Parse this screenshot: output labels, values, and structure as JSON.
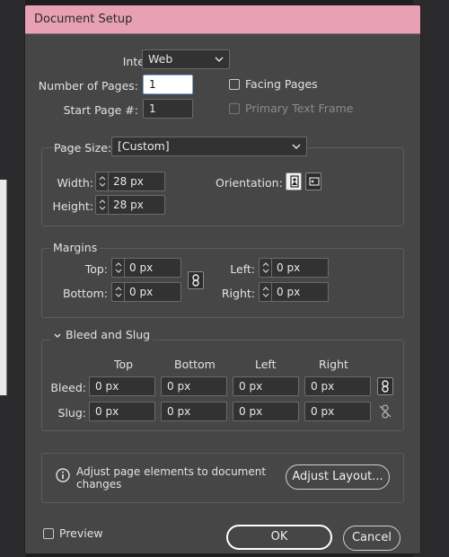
{
  "window": {
    "title": "Document Setup"
  },
  "general": {
    "intent_label": "Intent:",
    "intent_value": "Web",
    "num_pages_label": "Number of Pages:",
    "num_pages_value": "1",
    "start_page_label": "Start Page #:",
    "start_page_value": "1",
    "facing_pages_label": "Facing Pages",
    "facing_pages_checked": false,
    "primary_text_frame_label": "Primary Text Frame",
    "primary_text_frame_checked": false
  },
  "page_size": {
    "label": "Page Size:",
    "value": "[Custom]",
    "width_label": "Width:",
    "width_value": "28 px",
    "height_label": "Height:",
    "height_value": "28 px",
    "orientation_label": "Orientation:"
  },
  "margins": {
    "title": "Margins",
    "top_label": "Top:",
    "top_value": "0 px",
    "bottom_label": "Bottom:",
    "bottom_value": "0 px",
    "left_label": "Left:",
    "left_value": "0 px",
    "right_label": "Right:",
    "right_value": "0 px"
  },
  "bleed_slug": {
    "title": "Bleed and Slug",
    "columns": [
      "Top",
      "Bottom",
      "Left",
      "Right"
    ],
    "bleed_label": "Bleed:",
    "bleed_values": [
      "0 px",
      "0 px",
      "0 px",
      "0 px"
    ],
    "slug_label": "Slug:",
    "slug_values": [
      "0 px",
      "0 px",
      "0 px",
      "0 px"
    ]
  },
  "info": {
    "message_line1": "Adjust page elements to document",
    "message_line2": "changes",
    "adjust_button": "Adjust Layout..."
  },
  "footer": {
    "preview_label": "Preview",
    "ok_label": "OK",
    "cancel_label": "Cancel"
  },
  "colors": {
    "titlebar": "#e8a0b4",
    "dialog_bg": "#464646",
    "field_bg": "#323232"
  }
}
